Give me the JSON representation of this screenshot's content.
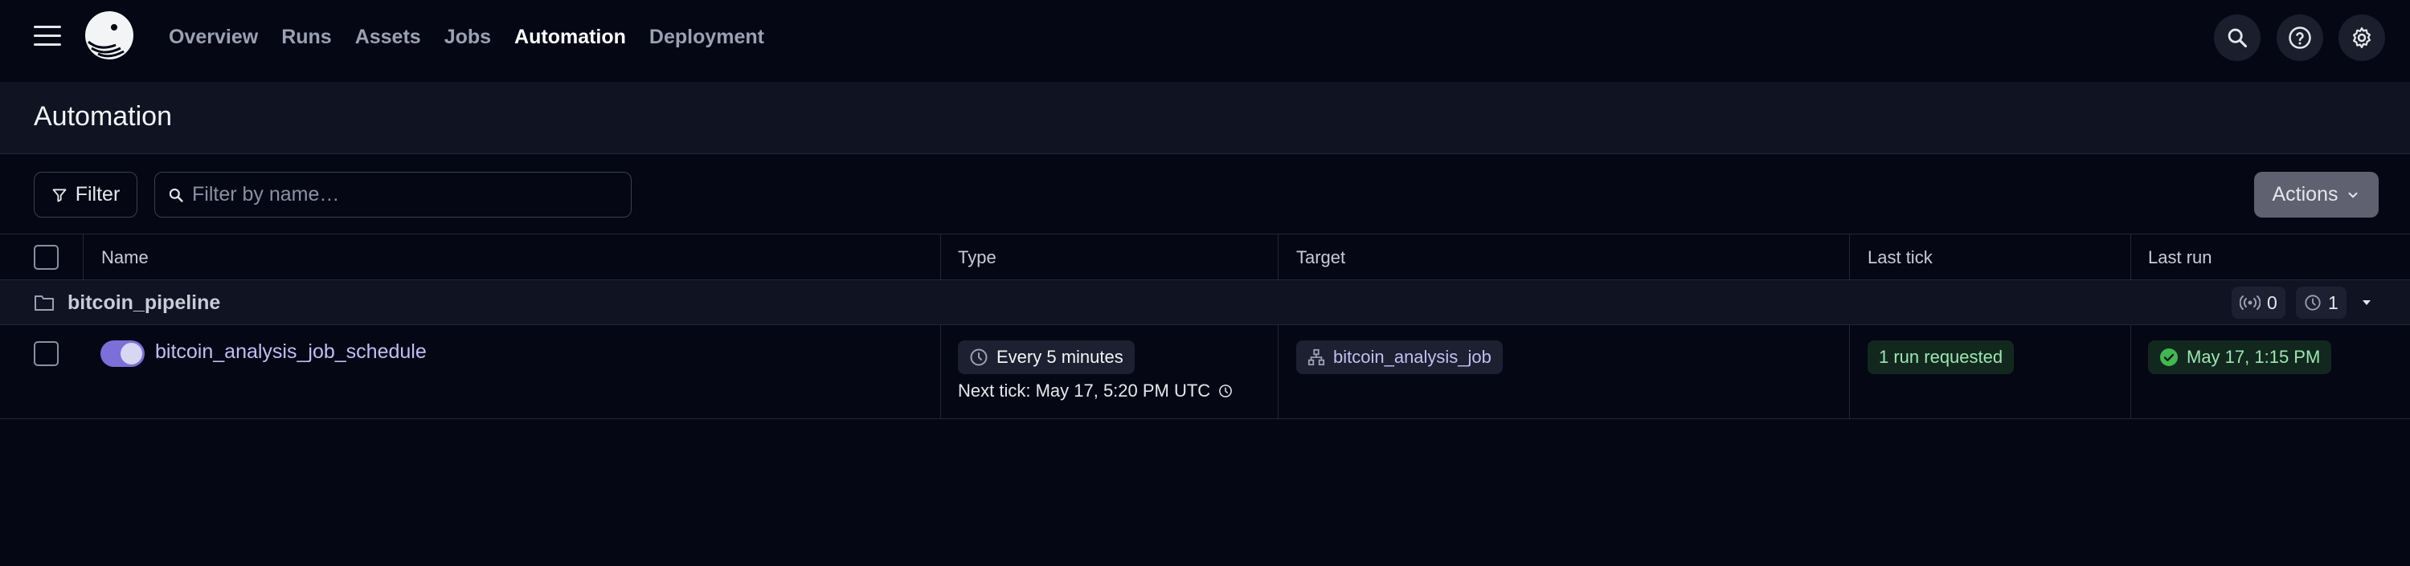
{
  "nav": {
    "links": [
      "Overview",
      "Runs",
      "Assets",
      "Jobs",
      "Automation",
      "Deployment"
    ],
    "active": "Automation"
  },
  "page": {
    "title": "Automation"
  },
  "toolbar": {
    "filter_label": "Filter",
    "search_placeholder": "Filter by name…",
    "actions_label": "Actions"
  },
  "table": {
    "columns": [
      "Name",
      "Type",
      "Target",
      "Last tick",
      "Last run"
    ],
    "group": {
      "name": "bitcoin_pipeline",
      "sensor_count": "0",
      "schedule_count": "1"
    },
    "rows": [
      {
        "name": "bitcoin_analysis_job_schedule",
        "enabled": true,
        "type": "Every 5 minutes",
        "next_tick": "Next tick: May 17, 5:20 PM UTC",
        "target": "bitcoin_analysis_job",
        "last_tick": "1 run requested",
        "last_run": "May 17, 1:15 PM"
      }
    ]
  },
  "colors": {
    "background": "#050714",
    "accent": "#7c6fd8",
    "success": "#3fb950",
    "link": "#c3bdf3"
  }
}
